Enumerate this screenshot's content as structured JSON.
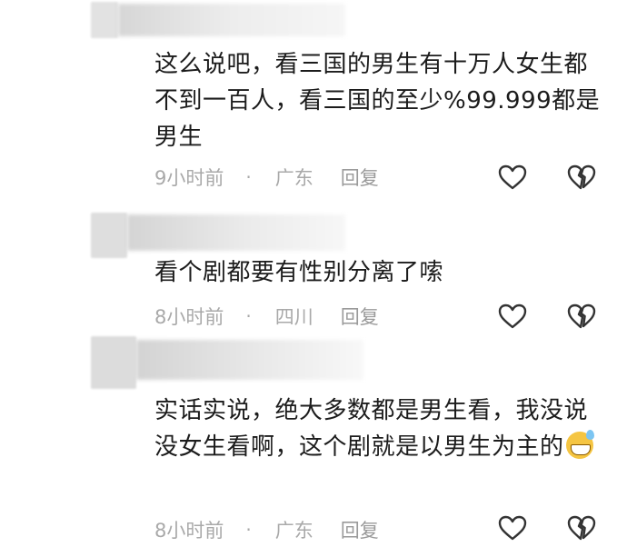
{
  "comments": [
    {
      "text": "这么说吧，看三国的男生有十万人女生都不到一百人，看三国的至少%99.999都是男生",
      "time": "9小时前",
      "location": "广东",
      "reply_label": "回复"
    },
    {
      "text": "看个剧都要有性别分离了嗦",
      "time": "8小时前",
      "location": "四川",
      "reply_label": "回复"
    },
    {
      "text": "实话实说，绝大多数都是男生看，我没说没女生看啊，这个剧就是以男生为主的",
      "time": "8小时前",
      "location": "广东",
      "reply_label": "回复"
    }
  ],
  "separator": "·",
  "icons": {
    "like": "heart-outline-icon",
    "dislike": "broken-heart-icon"
  },
  "emoji": "grinning-sweat-emoji"
}
